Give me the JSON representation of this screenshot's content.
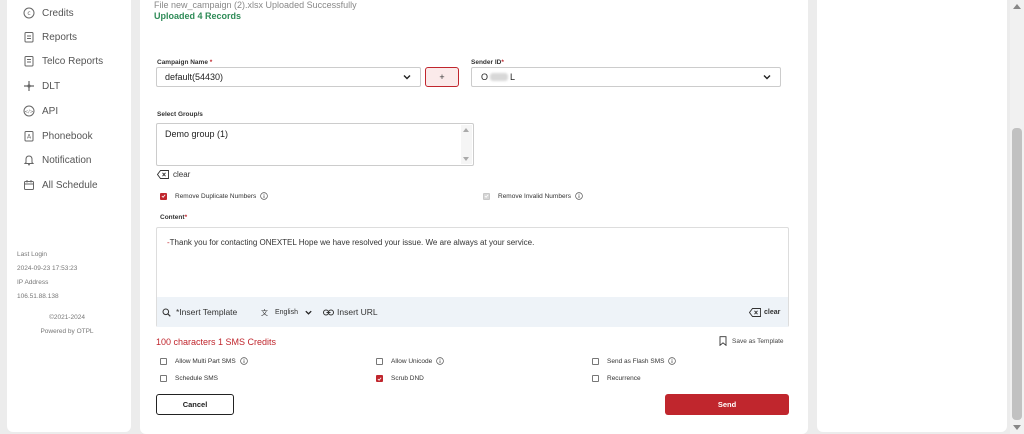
{
  "sidebar": {
    "items": [
      {
        "label": "Credits",
        "icon": "credits-icon"
      },
      {
        "label": "Reports",
        "icon": "reports-icon"
      },
      {
        "label": "Telco Reports",
        "icon": "telco-reports-icon"
      },
      {
        "label": "DLT",
        "icon": "dlt-icon"
      },
      {
        "label": "API",
        "icon": "api-icon"
      },
      {
        "label": "Phonebook",
        "icon": "phonebook-icon"
      },
      {
        "label": "Notification",
        "icon": "bell-icon"
      },
      {
        "label": "All Schedule",
        "icon": "calendar-icon"
      }
    ],
    "last_login_label": "Last Login",
    "last_login_value": "2024-09-23 17:53:23",
    "ip_label": "IP Address",
    "ip_value": "106.51.88.138",
    "copyright": "©2021-2024",
    "powered_by": "Powered by OTPL"
  },
  "upload": {
    "file_message": "File new_campaign (2).xlsx Uploaded Successfully",
    "records_message": "Uploaded 4 Records"
  },
  "form": {
    "campaign_label": "Campaign Name",
    "campaign_value": "default(54430)",
    "add_button": "+",
    "sender_label": "Sender ID",
    "sender_value_start": "O",
    "sender_value_end": "L",
    "groups_label": "Select Group/s",
    "group_value": "Demo group (1)",
    "clear_label": "clear",
    "remove_duplicates": "Remove Duplicate Numbers",
    "remove_invalid": "Remove Invalid Numbers",
    "content_label": "Content",
    "content_dash": "-",
    "content_text": "Thank you for contacting ONEXTEL  Hope we have resolved your issue. We are always at your service.",
    "toolbar": {
      "insert_template": "*Insert Template",
      "language": "English",
      "insert_url": "Insert URL",
      "clear": "clear"
    },
    "char_count": "100 characters 1 SMS Credits",
    "save_template": "Save as Template",
    "options": {
      "multi_part": "Allow Multi Part SMS",
      "unicode": "Allow Unicode",
      "flash": "Send as Flash SMS",
      "schedule": "Schedule SMS",
      "scrub_dnd": "Scrub DND",
      "recurrence": "Recurrence"
    },
    "cancel_button": "Cancel",
    "send_button": "Send"
  },
  "colors": {
    "accent": "#c0262d",
    "success": "#2e8b57"
  }
}
